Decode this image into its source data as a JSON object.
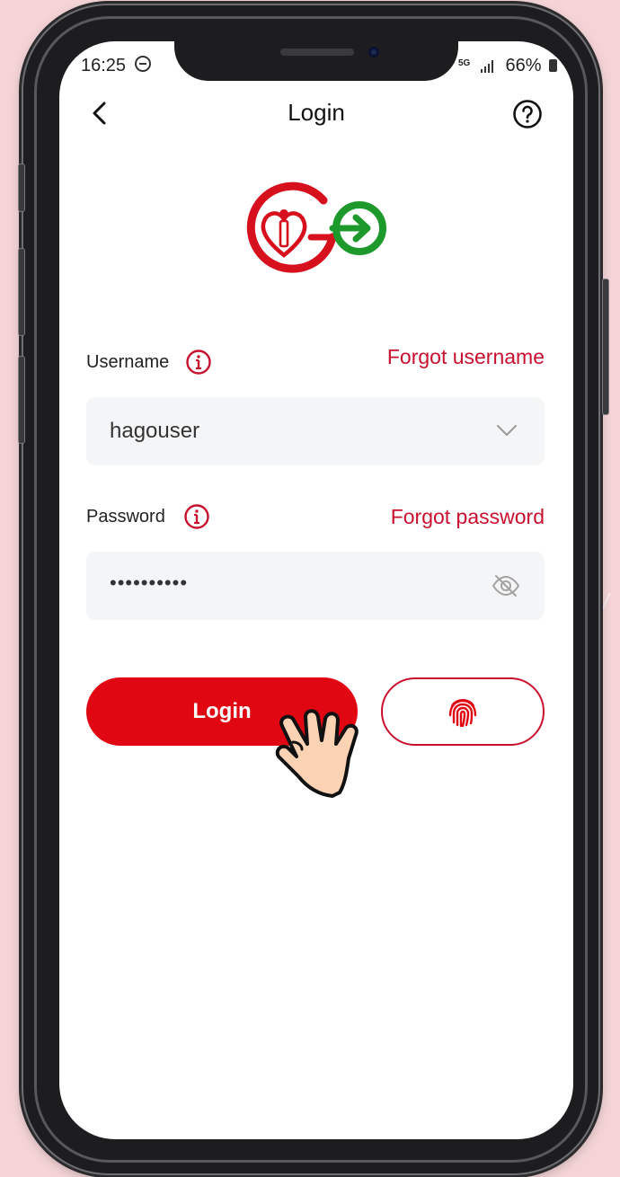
{
  "status_bar": {
    "time": "16:25",
    "network": "5G",
    "battery": "66%"
  },
  "header": {
    "title": "Login"
  },
  "username": {
    "label": "Username",
    "forgot_link": "Forgot username",
    "value": "hagouser"
  },
  "password": {
    "label": "Password",
    "forgot_link": "Forgot password",
    "masked_value": "••••••••••"
  },
  "actions": {
    "login_label": "Login"
  },
  "icons": {
    "back": "chevron-left-icon",
    "help": "question-circle-icon",
    "info": "info-circle-icon",
    "dropdown": "chevron-down-icon",
    "visibility": "eye-slash-icon",
    "biometric": "fingerprint-icon",
    "pointer": "tap-hand-icon"
  },
  "colors": {
    "accent_red": "#c8102e",
    "button_red": "#e10712",
    "logo_green": "#1e9a2c",
    "field_bg": "#f4f5f7",
    "page_bg": "#f4d4d6"
  }
}
